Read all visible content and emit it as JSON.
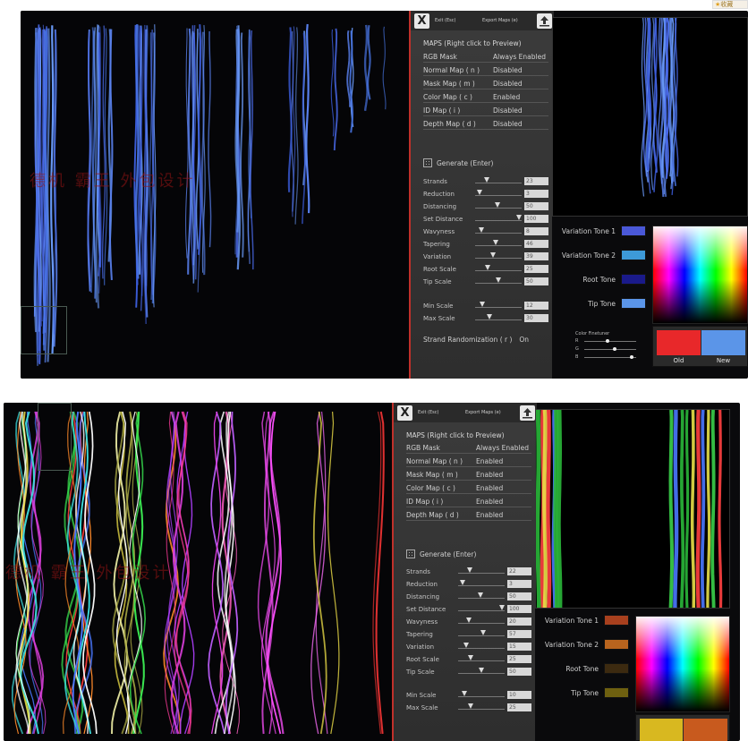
{
  "badge": "收藏",
  "watermark": "德机 霸王 外包设计",
  "panel1": {
    "exit": "Exit (Esc)",
    "export": "Export Maps (e)",
    "close_label": "X",
    "maps_title": "MAPS (Right click to Preview)",
    "maps": [
      {
        "label": "RGB Mask",
        "value": "Always Enabled"
      },
      {
        "label": "Normal Map ( n )",
        "value": "Disabled"
      },
      {
        "label": "Mask Map  ( m )",
        "value": "Disabled"
      },
      {
        "label": "Color Map  ( c )",
        "value": "Enabled"
      },
      {
        "label": "ID Map      ( i )",
        "value": "Disabled"
      },
      {
        "label": "Depth Map  ( d )",
        "value": "Disabled"
      }
    ],
    "generate": "Generate (Enter)",
    "sliders": [
      {
        "label": "Strands",
        "value": "23",
        "pos": 0.2
      },
      {
        "label": "Reduction",
        "value": "3",
        "pos": 0.05
      },
      {
        "label": "Distancing",
        "value": "50",
        "pos": 0.45
      },
      {
        "label": "Set Distance",
        "value": "100",
        "pos": 0.95
      },
      {
        "label": "Wavyness",
        "value": "8",
        "pos": 0.08
      },
      {
        "label": "Tapering",
        "value": "46",
        "pos": 0.42
      },
      {
        "label": "Variation",
        "value": "39",
        "pos": 0.36
      },
      {
        "label": "Root Scale",
        "value": "25",
        "pos": 0.22
      },
      {
        "label": "Tip Scale",
        "value": "50",
        "pos": 0.47
      }
    ],
    "scale_sliders": [
      {
        "label": "Min Scale",
        "value": "12",
        "pos": 0.1
      },
      {
        "label": "Max Scale",
        "value": "30",
        "pos": 0.28
      }
    ],
    "randomization": "Strand Randomization ( r )",
    "randomization_value": "On",
    "tones": [
      {
        "label": "Variation Tone 1",
        "color": "#4a58d8"
      },
      {
        "label": "Variation Tone 2",
        "color": "#3d9ad8"
      },
      {
        "label": "Root Tone",
        "color": "#1a1a8a"
      },
      {
        "label": "Tip Tone",
        "color": "#5b95e8"
      }
    ],
    "finetuner": {
      "title": "Color Finetuner",
      "r": "R",
      "g": "G",
      "b": "B",
      "rpos": 0.45,
      "gpos": 0.6,
      "bpos": 0.95
    },
    "old_label": "Old",
    "new_label": "New",
    "old_color": "#e8282a",
    "new_color": "#5b95e8"
  },
  "panel2": {
    "exit": "Exit (Esc)",
    "export": "Export Maps (e)",
    "close_label": "X",
    "maps_title": "MAPS (Right click to Preview)",
    "maps": [
      {
        "label": "RGB Mask",
        "value": "Always Enabled"
      },
      {
        "label": "Normal Map ( n )",
        "value": "Enabled"
      },
      {
        "label": "Mask Map  ( m )",
        "value": "Enabled"
      },
      {
        "label": "Color Map  ( c )",
        "value": "Enabled"
      },
      {
        "label": "ID Map      ( i )",
        "value": "Enabled"
      },
      {
        "label": "Depth Map  ( d )",
        "value": "Enabled"
      }
    ],
    "generate": "Generate (Enter)",
    "sliders": [
      {
        "label": "Strands",
        "value": "22",
        "pos": 0.2
      },
      {
        "label": "Reduction",
        "value": "3",
        "pos": 0.05
      },
      {
        "label": "Distancing",
        "value": "50",
        "pos": 0.45
      },
      {
        "label": "Set Distance",
        "value": "100",
        "pos": 0.95
      },
      {
        "label": "Wavyness",
        "value": "20",
        "pos": 0.18
      },
      {
        "label": "Tapering",
        "value": "57",
        "pos": 0.52
      },
      {
        "label": "Variation",
        "value": "15",
        "pos": 0.12
      },
      {
        "label": "Root Scale",
        "value": "25",
        "pos": 0.22
      },
      {
        "label": "Tip Scale",
        "value": "50",
        "pos": 0.47
      }
    ],
    "scale_sliders": [
      {
        "label": "Min Scale",
        "value": "10",
        "pos": 0.08
      },
      {
        "label": "Max Scale",
        "value": "25",
        "pos": 0.22
      }
    ],
    "tones": [
      {
        "label": "Variation Tone 1",
        "color": "#a8401e"
      },
      {
        "label": "Variation Tone 2",
        "color": "#b8641e"
      },
      {
        "label": "Root Tone",
        "color": "#3c2a10"
      },
      {
        "label": "Tip Tone",
        "color": "#6e6010"
      }
    ],
    "old_color": "#d8b820",
    "new_color": "#c85a1e"
  }
}
